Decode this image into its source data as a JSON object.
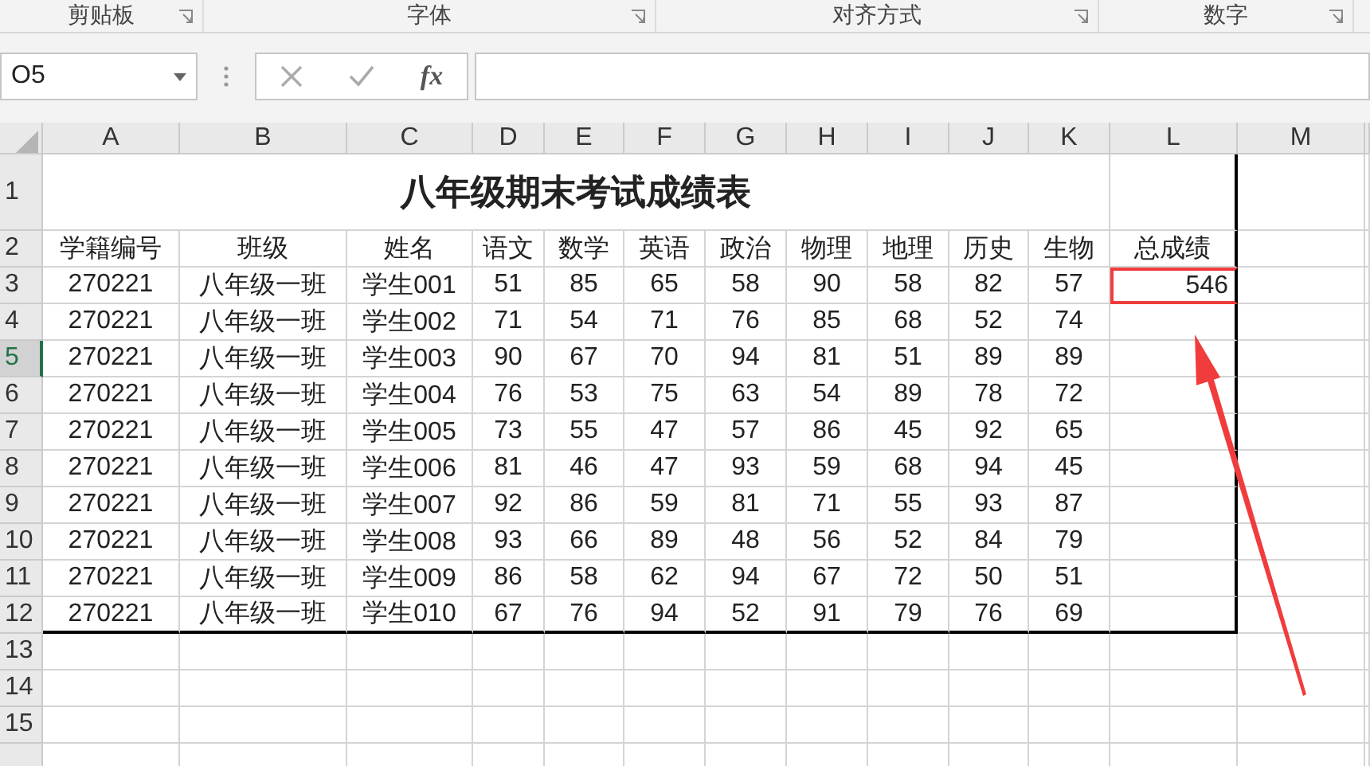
{
  "ribbon_groups": [
    {
      "label": "剪贴板"
    },
    {
      "label": "字体"
    },
    {
      "label": "对齐方式"
    },
    {
      "label": "数字"
    }
  ],
  "formula_bar": {
    "name_box": "O5",
    "function_button": "fx"
  },
  "sheet": {
    "columns": [
      "A",
      "B",
      "C",
      "D",
      "E",
      "F",
      "G",
      "H",
      "I",
      "J",
      "K",
      "L",
      "M"
    ],
    "rows": [
      {
        "header": "1",
        "selected": false,
        "title": "八年级期末考试成绩表",
        "total_highlighted": false
      },
      {
        "header": "2",
        "selected": false,
        "cells": [
          "学籍编号",
          "班级",
          "姓名",
          "语文",
          "数学",
          "英语",
          "政治",
          "物理",
          "地理",
          "历史",
          "生物"
        ],
        "total": "总成绩",
        "total_highlighted": false
      },
      {
        "header": "3",
        "selected": false,
        "cells": [
          "270221",
          "八年级一班",
          "学生001",
          "51",
          "85",
          "65",
          "58",
          "90",
          "58",
          "82",
          "57"
        ],
        "total": "546",
        "total_highlighted": true
      },
      {
        "header": "4",
        "selected": false,
        "cells": [
          "270221",
          "八年级一班",
          "学生002",
          "71",
          "54",
          "71",
          "76",
          "85",
          "68",
          "52",
          "74"
        ],
        "total_highlighted": false
      },
      {
        "header": "5",
        "selected": true,
        "cells": [
          "270221",
          "八年级一班",
          "学生003",
          "90",
          "67",
          "70",
          "94",
          "81",
          "51",
          "89",
          "89"
        ],
        "total_highlighted": false
      },
      {
        "header": "6",
        "selected": false,
        "cells": [
          "270221",
          "八年级一班",
          "学生004",
          "76",
          "53",
          "75",
          "63",
          "54",
          "89",
          "78",
          "72"
        ],
        "total_highlighted": false
      },
      {
        "header": "7",
        "selected": false,
        "cells": [
          "270221",
          "八年级一班",
          "学生005",
          "73",
          "55",
          "47",
          "57",
          "86",
          "45",
          "92",
          "65"
        ],
        "total_highlighted": false
      },
      {
        "header": "8",
        "selected": false,
        "cells": [
          "270221",
          "八年级一班",
          "学生006",
          "81",
          "46",
          "47",
          "93",
          "59",
          "68",
          "94",
          "45"
        ],
        "total_highlighted": false
      },
      {
        "header": "9",
        "selected": false,
        "cells": [
          "270221",
          "八年级一班",
          "学生007",
          "92",
          "86",
          "59",
          "81",
          "71",
          "55",
          "93",
          "87"
        ],
        "total_highlighted": false
      },
      {
        "header": "10",
        "selected": false,
        "cells": [
          "270221",
          "八年级一班",
          "学生008",
          "93",
          "66",
          "89",
          "48",
          "56",
          "52",
          "84",
          "79"
        ],
        "total_highlighted": false
      },
      {
        "header": "11",
        "selected": false,
        "cells": [
          "270221",
          "八年级一班",
          "学生009",
          "86",
          "58",
          "62",
          "94",
          "67",
          "72",
          "50",
          "51"
        ],
        "total_highlighted": false
      },
      {
        "header": "12",
        "selected": false,
        "cells": [
          "270221",
          "八年级一班",
          "学生010",
          "67",
          "76",
          "94",
          "52",
          "91",
          "79",
          "76",
          "69"
        ],
        "total_highlighted": false
      },
      {
        "header": "13",
        "selected": false,
        "total_highlighted": false
      },
      {
        "header": "14",
        "selected": false,
        "total_highlighted": false
      },
      {
        "header": "15",
        "selected": false,
        "total_highlighted": false
      }
    ]
  }
}
